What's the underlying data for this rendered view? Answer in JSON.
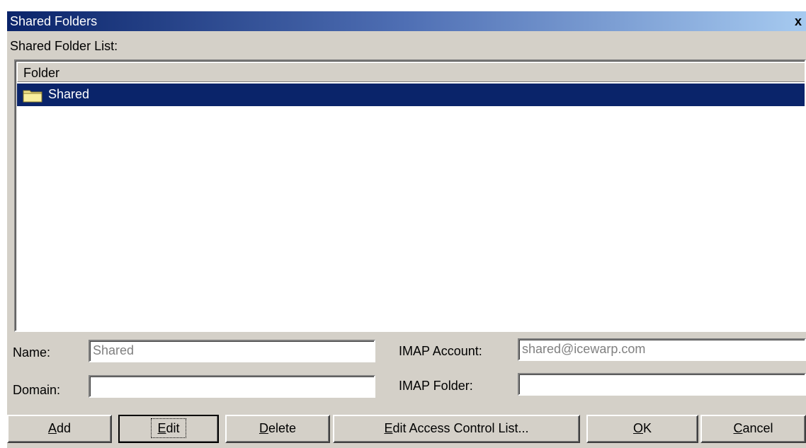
{
  "window": {
    "title": "Shared Folders",
    "close_label": "x"
  },
  "list": {
    "section_label": "Shared Folder List:",
    "column_header": "Folder",
    "rows": [
      {
        "label": "Shared",
        "selected": true,
        "icon": "folder-icon"
      }
    ]
  },
  "form": {
    "name_label": "Name:",
    "name_value": "Shared",
    "domain_label": "Domain:",
    "domain_value": "",
    "imap_account_label": "IMAP Account:",
    "imap_account_value": "shared@icewarp.com",
    "imap_folder_label": "IMAP Folder:",
    "imap_folder_value": ""
  },
  "buttons": {
    "add": {
      "mnemonic": "A",
      "rest": "dd"
    },
    "edit": {
      "mnemonic": "E",
      "rest": "dit"
    },
    "delete": {
      "mnemonic": "D",
      "rest": "elete"
    },
    "edit_acl": {
      "mnemonic": "E",
      "rest": "dit Access Control List..."
    },
    "ok": {
      "mnemonic": "O",
      "rest": "K"
    },
    "cancel": {
      "mnemonic": "C",
      "rest": "ancel"
    }
  },
  "colors": {
    "selection": "#0a246a",
    "dialog_face": "#d4d0c8"
  }
}
